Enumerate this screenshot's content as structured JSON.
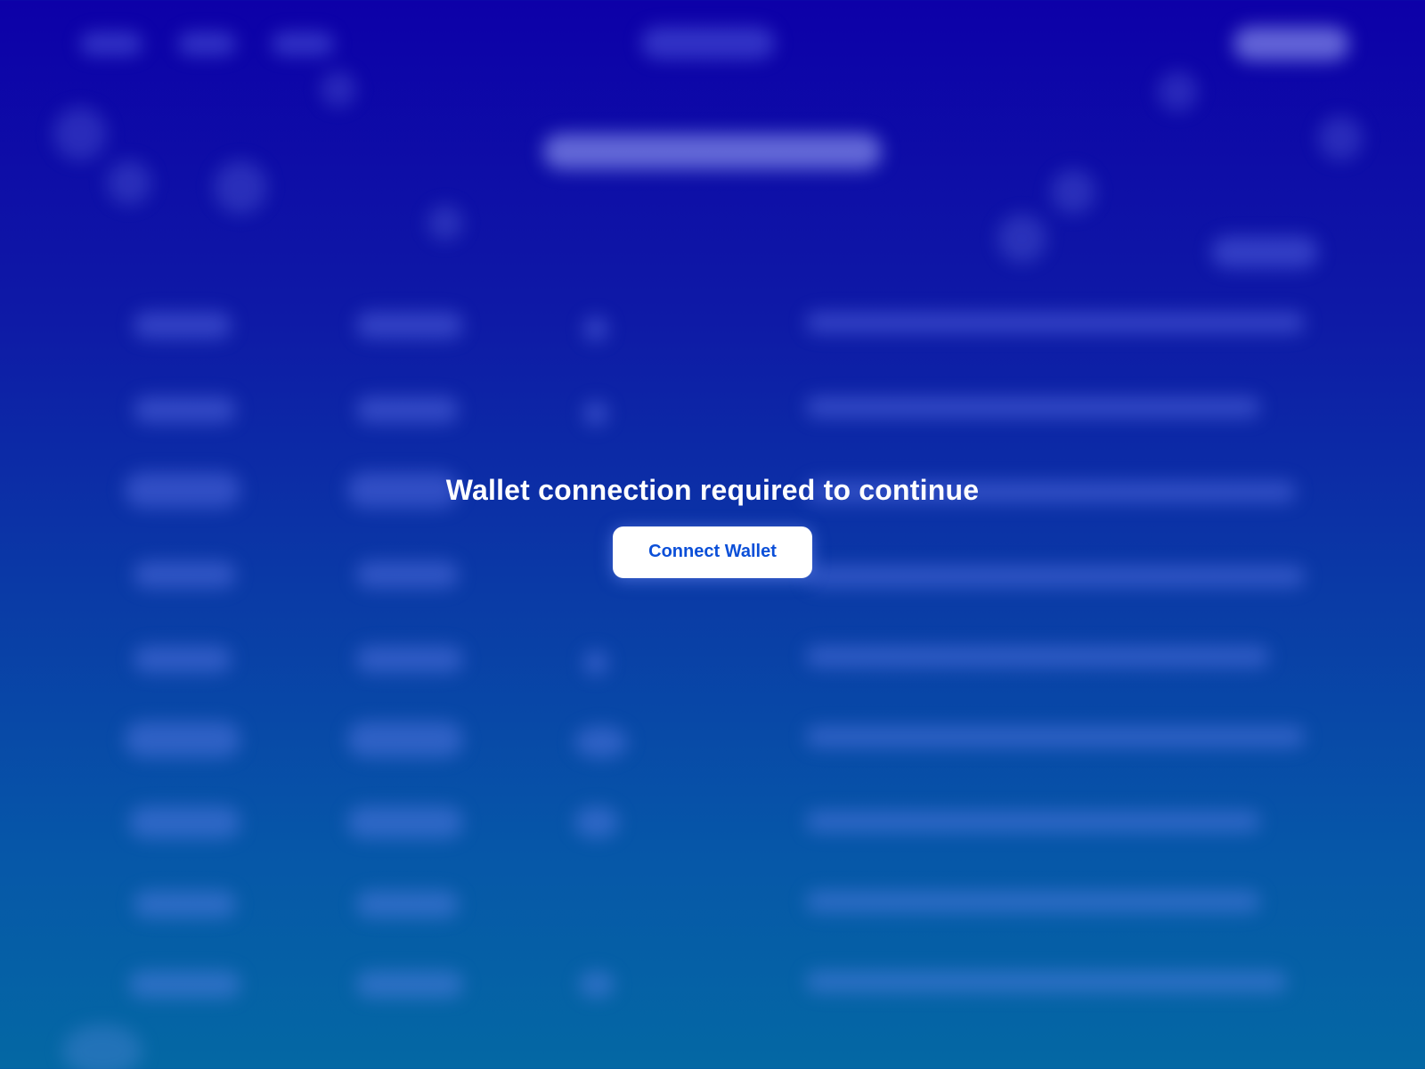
{
  "overlay": {
    "message": "Wallet connection required to continue",
    "button_label": "Connect Wallet"
  },
  "colors": {
    "background_top": "#0d00a8",
    "background_bottom": "#0468a4",
    "button_bg": "#ffffff",
    "button_text": "#0b4fd8"
  }
}
